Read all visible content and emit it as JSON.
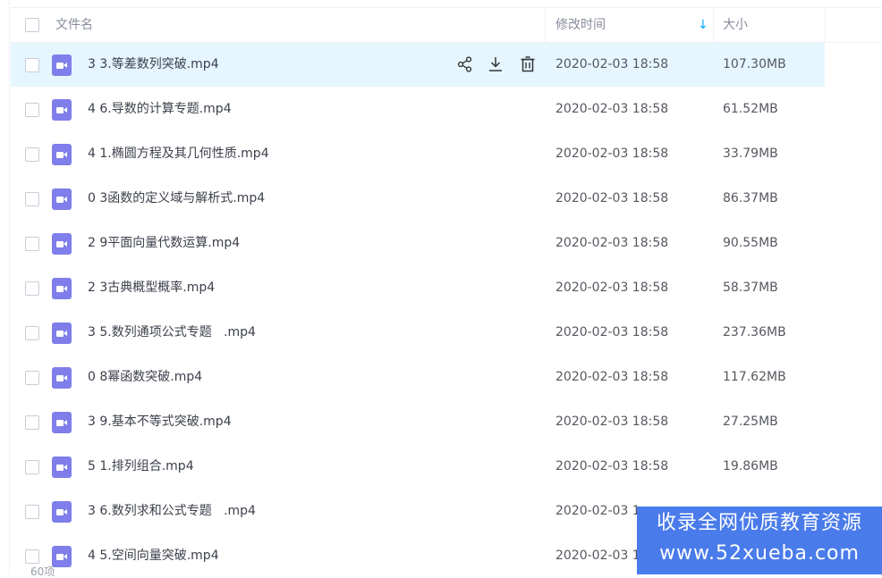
{
  "header": {
    "name_label": "文件名",
    "time_label": "修改时间",
    "size_label": "大小",
    "sort_indicator": "↓"
  },
  "actions": {
    "share_icon": "share-icon",
    "download_icon": "download-icon",
    "delete_icon": "trash-icon"
  },
  "files": [
    {
      "name": "3 3.等差数列突破.mp4",
      "time": "2020-02-03 18:58",
      "size": "107.30MB"
    },
    {
      "name": "4 6.导数的计算专题.mp4",
      "time": "2020-02-03 18:58",
      "size": "61.52MB"
    },
    {
      "name": "4 1.椭圆方程及其几何性质.mp4",
      "time": "2020-02-03 18:58",
      "size": "33.79MB"
    },
    {
      "name": "0 3函数的定义域与解析式.mp4",
      "time": "2020-02-03 18:58",
      "size": "86.37MB"
    },
    {
      "name": "2 9平面向量代数运算.mp4",
      "time": "2020-02-03 18:58",
      "size": "90.55MB"
    },
    {
      "name": "2 3古典概型概率.mp4",
      "time": "2020-02-03 18:58",
      "size": "58.37MB"
    },
    {
      "name": "3 5.数列通项公式专题   .mp4",
      "time": "2020-02-03 18:58",
      "size": "237.36MB"
    },
    {
      "name": "0 8幂函数突破.mp4",
      "time": "2020-02-03 18:58",
      "size": "117.62MB"
    },
    {
      "name": "3 9.基本不等式突破.mp4",
      "time": "2020-02-03 18:58",
      "size": "27.25MB"
    },
    {
      "name": "5 1.排列组合.mp4",
      "time": "2020-02-03 18:58",
      "size": "19.86MB"
    },
    {
      "name": "3 6.数列求和公式专题   .mp4",
      "time": "2020-02-03 1",
      "size": ""
    },
    {
      "name": "4 5.空间向量突破.mp4",
      "time": "2020-02-03 1",
      "size": ""
    }
  ],
  "footer": {
    "count": "60项"
  },
  "watermark": {
    "line1": "收录全网优质教育资源",
    "line2": "www.52xueba.com"
  },
  "colors": {
    "accent": "#06a7ff",
    "row_hover": "#e5f6ff",
    "file_icon": "#7f7eea",
    "watermark_bg": "#3a70e8"
  }
}
